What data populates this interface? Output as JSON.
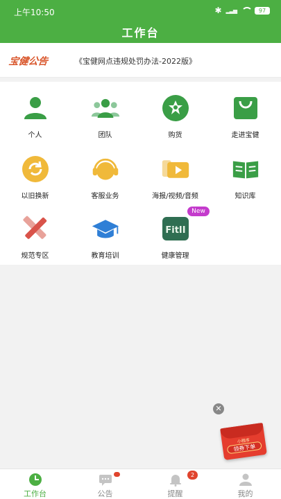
{
  "status": {
    "time": "上午10:50",
    "battery": "97"
  },
  "header": {
    "title": "工作台"
  },
  "notice": {
    "logo": "宝健公告",
    "text": "《宝健网点违规处罚办法-2022版》"
  },
  "grid": [
    {
      "label": "个人",
      "icon": "person-icon"
    },
    {
      "label": "团队",
      "icon": "team-icon"
    },
    {
      "label": "购货",
      "icon": "shopping-icon"
    },
    {
      "label": "走进宝健",
      "icon": "shopping-bag-icon"
    },
    {
      "label": "以旧换新",
      "icon": "exchange-icon"
    },
    {
      "label": "客服业务",
      "icon": "headset-icon"
    },
    {
      "label": "海报/视频/音频",
      "icon": "media-icon"
    },
    {
      "label": "知识库",
      "icon": "book-icon"
    },
    {
      "label": "规范专区",
      "icon": "ruler-pencil-icon"
    },
    {
      "label": "教育培训",
      "icon": "graduation-cap-icon"
    },
    {
      "label": "健康管理",
      "icon": "fit-icon",
      "icon_text": "FitII",
      "badge": "New"
    }
  ],
  "promo": {
    "small_text": "小程序",
    "main_text": "领券下单"
  },
  "tabs": [
    {
      "label": "工作台",
      "icon": "dashboard-icon",
      "active": true
    },
    {
      "label": "公告",
      "icon": "message-icon",
      "dot": true
    },
    {
      "label": "提醒",
      "icon": "bell-icon",
      "badge": "2"
    },
    {
      "label": "我的",
      "icon": "profile-icon"
    }
  ],
  "colors": {
    "brand_green": "#4caf43",
    "logo_orange": "#d9562b",
    "badge_red": "#e0442d",
    "new_purple": "#c43bcc"
  }
}
